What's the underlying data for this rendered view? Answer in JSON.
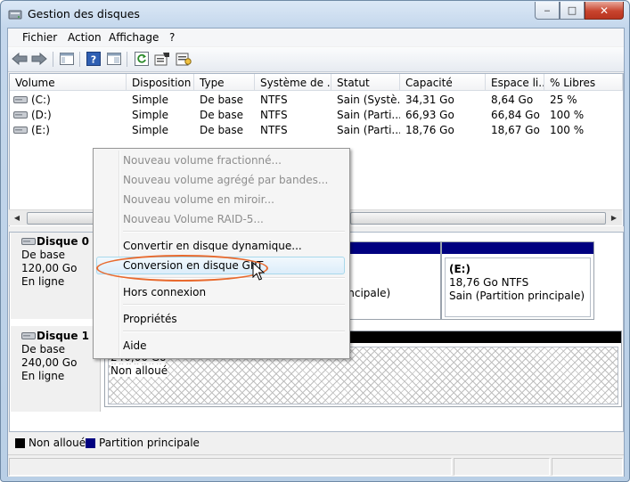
{
  "window": {
    "title": "Gestion des disques"
  },
  "caption_buttons": {
    "minimize": "‒",
    "maximize": "□",
    "close": "✕"
  },
  "menubar": [
    "Fichier",
    "Action",
    "Affichage",
    "?"
  ],
  "volume_list": {
    "columns": [
      "Volume",
      "Disposition",
      "Type",
      "Système de ...",
      "Statut",
      "Capacité",
      "Espace li...",
      "% Libres"
    ],
    "rows": [
      [
        "(C:)",
        "Simple",
        "De base",
        "NTFS",
        "Sain (Systè...",
        "34,31 Go",
        "8,64 Go",
        "25 %"
      ],
      [
        "(D:)",
        "Simple",
        "De base",
        "NTFS",
        "Sain (Parti...",
        "66,93 Go",
        "66,84 Go",
        "100 %"
      ],
      [
        "(E:)",
        "Simple",
        "De base",
        "NTFS",
        "Sain (Parti...",
        "18,76 Go",
        "18,67 Go",
        "100 %"
      ]
    ]
  },
  "disks": [
    {
      "name": "Disque 0",
      "type": "De base",
      "size": "120,00 Go",
      "status": "En ligne"
    },
    {
      "name": "Disque 1",
      "type": "De base",
      "size": "240,00 Go",
      "status": "En ligne"
    }
  ],
  "partitions": {
    "disk0_d_partial": "rincipale)",
    "disk0_e": {
      "label": "(E:)",
      "size": "18,76 Go NTFS",
      "status": "Sain (Partition principale)"
    },
    "disk1_unalloc": {
      "size": "240,00 Go",
      "status": "Non alloué"
    }
  },
  "legend": [
    {
      "label": "Non alloué",
      "color": "#000000"
    },
    {
      "label": "Partition principale",
      "color": "#000080"
    }
  ],
  "context_menu": {
    "items": [
      {
        "label": "Nouveau volume fractionné...",
        "enabled": false
      },
      {
        "label": "Nouveau volume agrégé par bandes...",
        "enabled": false
      },
      {
        "label": "Nouveau volume en miroir...",
        "enabled": false
      },
      {
        "label": "Nouveau Volume RAID-5...",
        "enabled": false
      },
      {
        "label": "Convertir en disque dynamique...",
        "enabled": true
      },
      {
        "label": "Conversion en disque GPT",
        "enabled": true,
        "hovered": true
      },
      {
        "label": "Hors connexion",
        "enabled": true
      },
      {
        "label": "Propriétés",
        "enabled": true
      },
      {
        "label": "Aide",
        "enabled": true
      }
    ]
  },
  "colors": {
    "primary_partition": "#000080",
    "unallocated": "#000000",
    "highlight_ellipse": "#e86a2e"
  }
}
